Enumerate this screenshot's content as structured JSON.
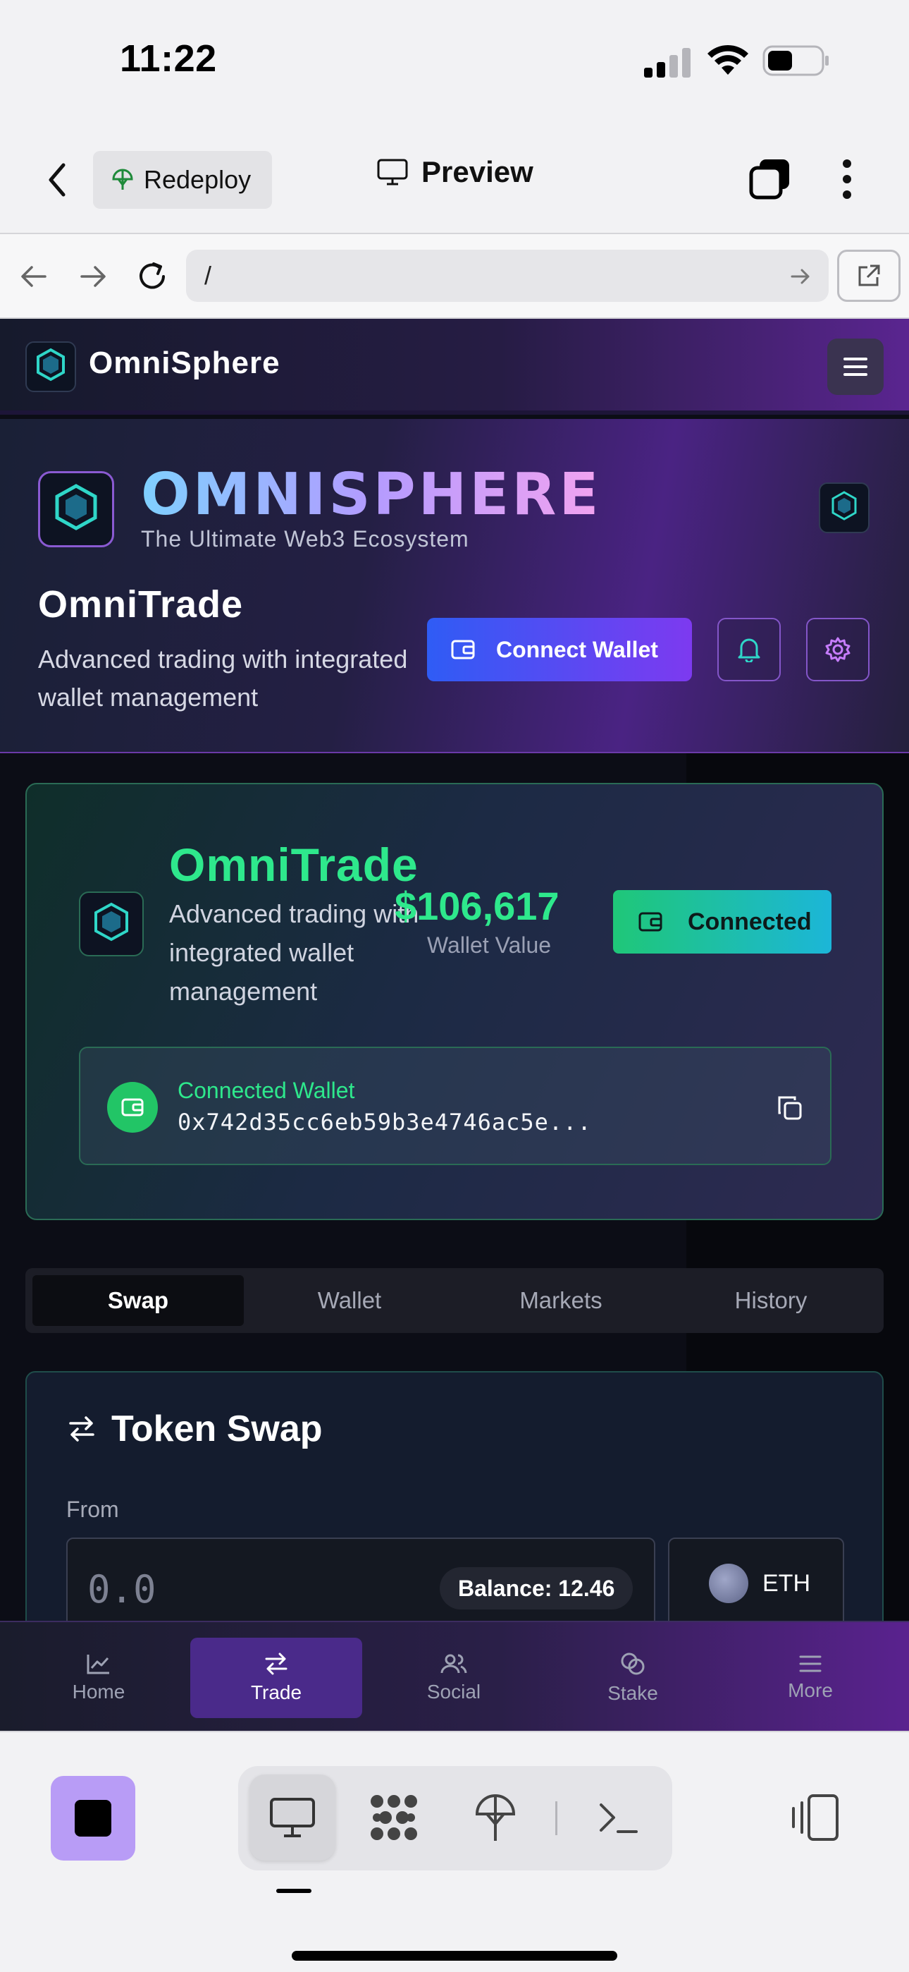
{
  "status_bar": {
    "time": "11:22"
  },
  "app_header": {
    "redeploy_label": "Redeploy",
    "preview_label": "Preview"
  },
  "browser": {
    "url": "/"
  },
  "site_nav": {
    "site_name": "OmniSphere"
  },
  "hero": {
    "brand_title": "OMNISPHERE",
    "brand_subtitle": "The Ultimate Web3 Ecosystem",
    "app_title": "OmniTrade",
    "app_desc": "Advanced trading with integrated wallet management",
    "connect_wallet_label": "Connect Wallet"
  },
  "wallet_card": {
    "title": "OmniTrade",
    "desc": "Advanced trading with integrated wallet management",
    "value": "$106,617",
    "value_label": "Wallet Value",
    "connected_label": "Connected",
    "wallet_label": "Connected Wallet",
    "wallet_address": "0x742d35cc6eb59b3e4746ac5e..."
  },
  "tabs": [
    "Swap",
    "Wallet",
    "Markets",
    "History"
  ],
  "swap": {
    "title": "Token Swap",
    "from_label": "From",
    "amount_placeholder": "0.0",
    "balance": "Balance: 12.46",
    "token": "ETH"
  },
  "bottom_nav": [
    "Home",
    "Trade",
    "Social",
    "Stake",
    "More"
  ],
  "colors": {
    "accent_green": "#2ee88c",
    "accent_purple": "#7d3af0",
    "accent_blue": "#2f5cf5"
  }
}
